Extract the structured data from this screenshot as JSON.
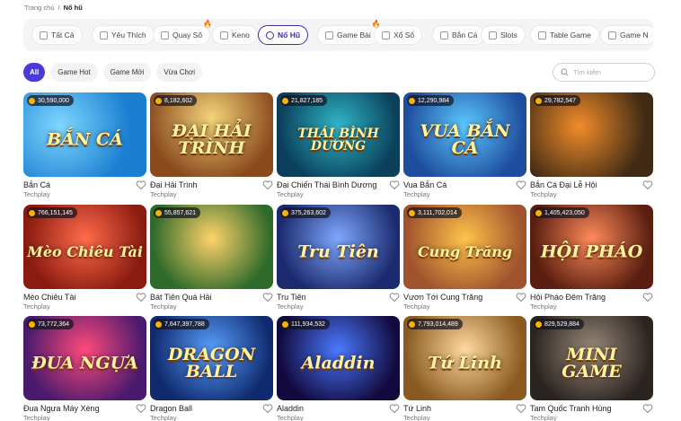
{
  "breadcrumb": {
    "home": "Trang chủ",
    "separator": "/",
    "current": "Nổ hũ"
  },
  "categories": [
    {
      "label": "Tất Cả",
      "icon": "grid-icon",
      "active": false,
      "hot": false
    },
    {
      "label": "Yêu Thích",
      "icon": "heart-icon",
      "active": false,
      "hot": false
    },
    {
      "label": "Quay Số",
      "icon": "lottery-icon",
      "active": false,
      "hot": true
    },
    {
      "label": "Keno",
      "icon": "keno-icon",
      "active": false,
      "hot": false
    },
    {
      "label": "Nổ Hũ",
      "icon": "jackpot-icon",
      "active": true,
      "hot": false
    },
    {
      "label": "Game Bài",
      "icon": "cards-icon",
      "active": false,
      "hot": true
    },
    {
      "label": "Xổ Số",
      "icon": "lotto-icon",
      "active": false,
      "hot": false
    },
    {
      "label": "Bắn Cá",
      "icon": "fish-icon",
      "active": false,
      "hot": false
    },
    {
      "label": "Slots",
      "icon": "diamond-icon",
      "active": false,
      "hot": false
    },
    {
      "label": "Table Game",
      "icon": "table-icon",
      "active": false,
      "hot": false
    },
    {
      "label": "Game N",
      "icon": "game-icon",
      "active": false,
      "hot": false
    }
  ],
  "filters": [
    "All",
    "Game Hot",
    "Game Mới",
    "Vừa Chơi"
  ],
  "search": {
    "placeholder": "Tìm kiếm"
  },
  "games": [
    {
      "name": "Bắn Cá",
      "provider": "Techplay",
      "jackpot": "30,590,000",
      "art": "BẮN CÁ"
    },
    {
      "name": "Đại Hải Trình",
      "provider": "Techplay",
      "jackpot": "8,182,602",
      "art": "ĐẠI HẢI TRÌNH"
    },
    {
      "name": "Đại Chiến Thái Bình Dương",
      "provider": "Techplay",
      "jackpot": "21,827,185",
      "art": "THÁI BÌNH DƯƠNG"
    },
    {
      "name": "Vua Bắn Cá",
      "provider": "Techplay",
      "jackpot": "12,290,984",
      "art": "VUA BẮN CÁ"
    },
    {
      "name": "Bắn Cá Đại Lễ Hội",
      "provider": "Techplay",
      "jackpot": "29,782,547",
      "art": ""
    },
    {
      "name": "Mèo Chiêu Tài",
      "provider": "Techplay",
      "jackpot": "766,151,145",
      "art": "Mèo Chiêu Tài"
    },
    {
      "name": "Bát Tiên Quá Hải",
      "provider": "Techplay",
      "jackpot": "55,857,621",
      "art": ""
    },
    {
      "name": "Tru Tiên",
      "provider": "Techplay",
      "jackpot": "375,263,602",
      "art": "Tru Tiên"
    },
    {
      "name": "Vươn Tới Cung Trăng",
      "provider": "Techplay",
      "jackpot": "3,111,702,014",
      "art": "Cung Trăng"
    },
    {
      "name": "Hội Pháo Đêm Trăng",
      "provider": "Techplay",
      "jackpot": "1,405,423,050",
      "art": "HỘI PHÁO"
    },
    {
      "name": "Đua Ngựa Máy Xèng",
      "provider": "Techplay",
      "jackpot": "73,772,364",
      "art": "ĐUA NGỰA"
    },
    {
      "name": "Dragon Ball",
      "provider": "Techplay",
      "jackpot": "7,647,397,788",
      "art": "DRAGON BALL"
    },
    {
      "name": "Aladdin",
      "provider": "Techplay",
      "jackpot": "111,934,532",
      "art": "Aladdin"
    },
    {
      "name": "Tứ Linh",
      "provider": "Techplay",
      "jackpot": "7,793,014,489",
      "art": "Tứ Linh"
    },
    {
      "name": "Tam Quốc Tranh Hùng",
      "provider": "Techplay",
      "jackpot": "829,529,884",
      "art": "MINI GAME"
    }
  ]
}
